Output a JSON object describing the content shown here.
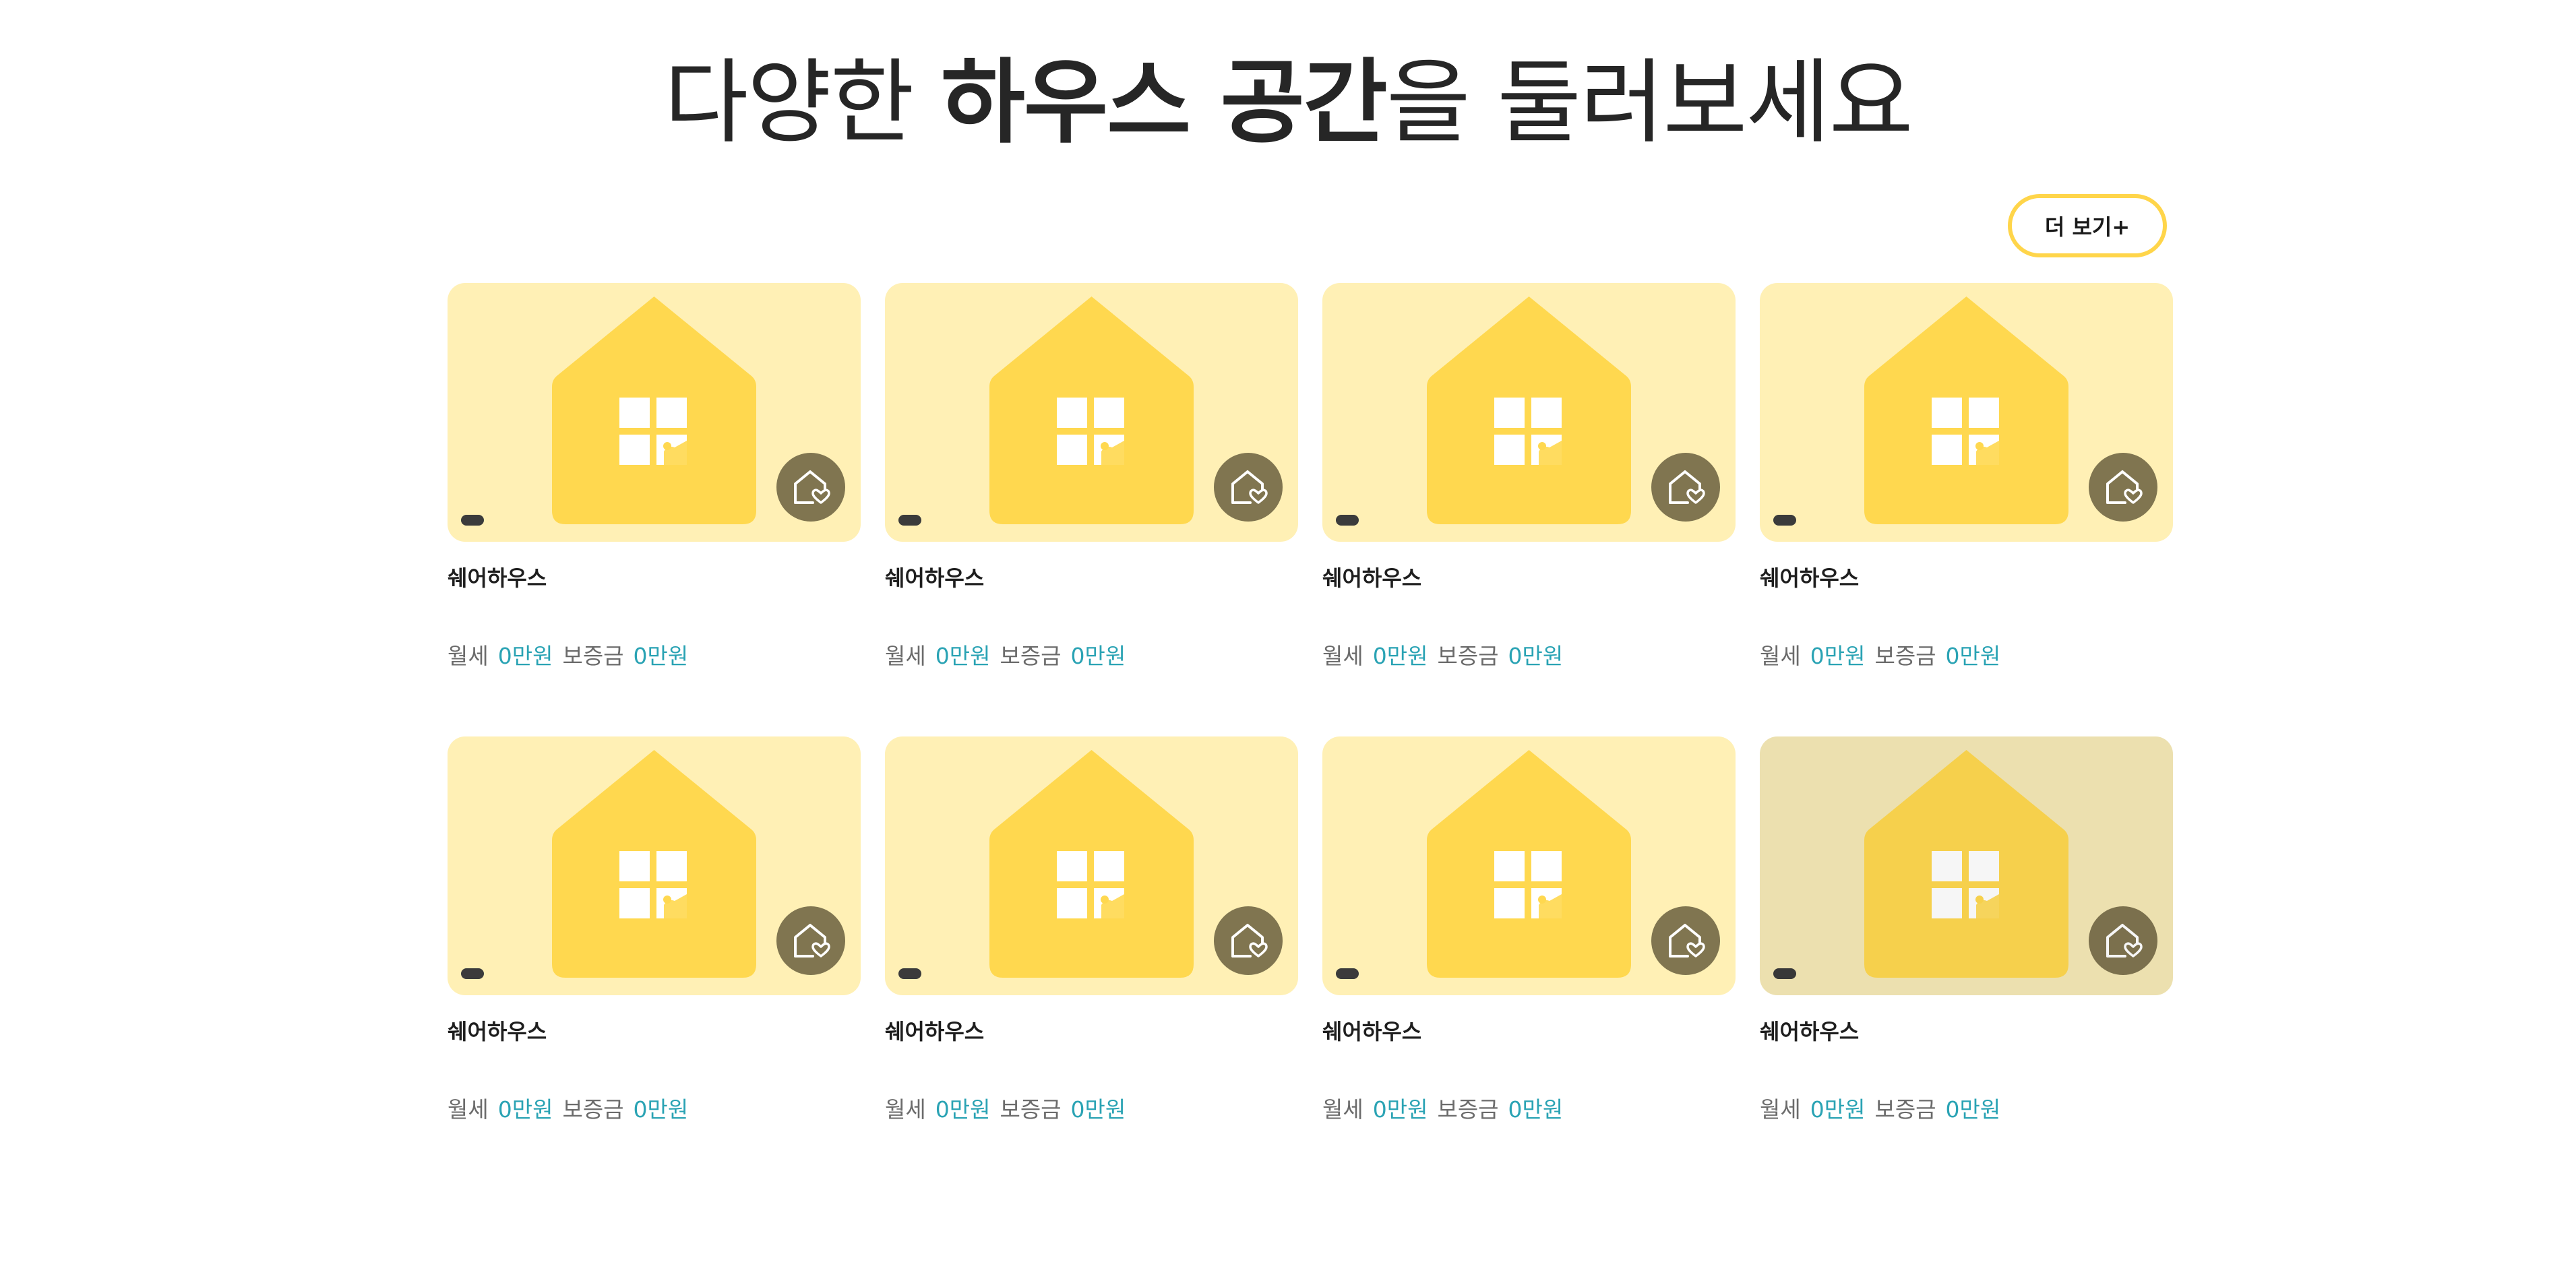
{
  "headline": {
    "part1": "다양한 ",
    "part2": "하우스 공간",
    "part3": "을 둘러보세요"
  },
  "more_button": {
    "label": "더 보기+"
  },
  "colors": {
    "accent": "#ffd54a",
    "thumb_bg": "#fff0b5",
    "house": "#ffd84f",
    "like_button": "#807550",
    "price_value": "#2aa3b4"
  },
  "icons": {
    "house_illustration": "house-illustration",
    "like": "house-heart-icon"
  },
  "listings": [
    {
      "title": "쉐어하우스",
      "rent_label": "월세",
      "rent_value": "0만원",
      "deposit_label": "보증금",
      "deposit_value": "0만원"
    },
    {
      "title": "쉐어하우스",
      "rent_label": "월세",
      "rent_value": "0만원",
      "deposit_label": "보증금",
      "deposit_value": "0만원"
    },
    {
      "title": "쉐어하우스",
      "rent_label": "월세",
      "rent_value": "0만원",
      "deposit_label": "보증금",
      "deposit_value": "0만원"
    },
    {
      "title": "쉐어하우스",
      "rent_label": "월세",
      "rent_value": "0만원",
      "deposit_label": "보증금",
      "deposit_value": "0만원"
    },
    {
      "title": "쉐어하우스",
      "rent_label": "월세",
      "rent_value": "0만원",
      "deposit_label": "보증금",
      "deposit_value": "0만원"
    },
    {
      "title": "쉐어하우스",
      "rent_label": "월세",
      "rent_value": "0만원",
      "deposit_label": "보증금",
      "deposit_value": "0만원"
    },
    {
      "title": "쉐어하우스",
      "rent_label": "월세",
      "rent_value": "0만원",
      "deposit_label": "보증금",
      "deposit_value": "0만원"
    },
    {
      "title": "쉐어하우스",
      "rent_label": "월세",
      "rent_value": "0만원",
      "deposit_label": "보증금",
      "deposit_value": "0만원"
    }
  ]
}
